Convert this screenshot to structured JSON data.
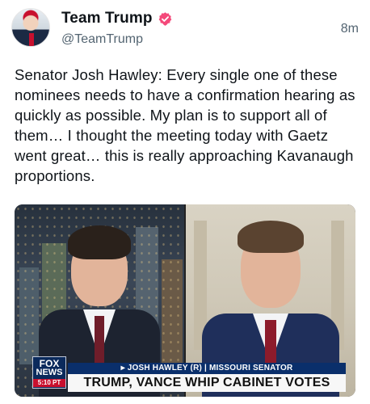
{
  "post": {
    "author": {
      "display_name": "Team Trump",
      "handle": "@TeamTrump",
      "verified_icon": "verified-badge-icon",
      "verified_color": "#f4497a"
    },
    "timestamp": "8m",
    "text": "Senator Josh Hawley: Every single one of these nominees needs to have a confirmation hearing as quickly as possible. My plan is to support all of them… I thought the meeting today with Gaetz went great… this is really approaching Kavanaugh proportions."
  },
  "video": {
    "network_logo": {
      "line1": "FOX",
      "line2": "NEWS",
      "time": "5:10 PT"
    },
    "lower_third_name": "▸ JOSH HAWLEY (R) | MISSOURI SENATOR",
    "headline": "TRUMP, VANCE WHIP CABINET VOTES",
    "brand_color": "#0a2f6b"
  }
}
